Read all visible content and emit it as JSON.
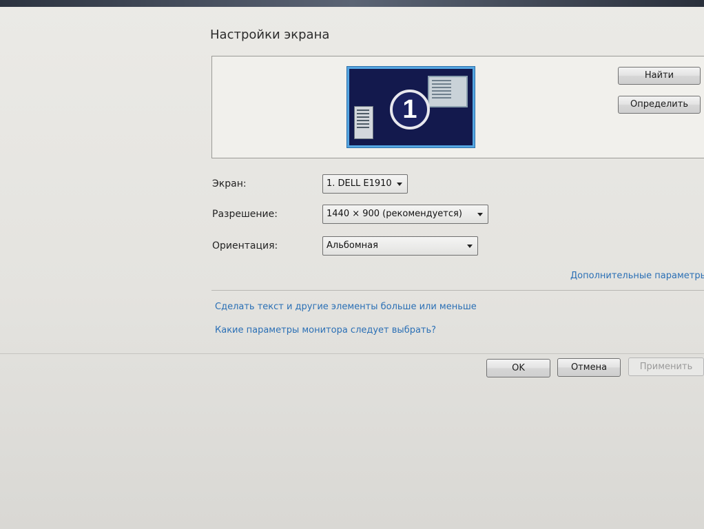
{
  "window": {
    "title": "Настройки экрана"
  },
  "preview": {
    "monitor_number": "1",
    "find_label": "Найти",
    "identify_label": "Определить"
  },
  "settings": {
    "screen_label": "Экран:",
    "screen_value": "1. DELL E1910",
    "resolution_label": "Разрешение:",
    "resolution_value": "1440 × 900 (рекомендуется)",
    "orientation_label": "Ориентация:",
    "orientation_value": "Альбомная"
  },
  "links": {
    "advanced": "Дополнительные параметры",
    "text_size": "Сделать текст и другие элементы больше или меньше",
    "monitor_help": "Какие параметры монитора следует выбрать?"
  },
  "footer": {
    "ok_label": "OK",
    "cancel_label": "Отмена",
    "apply_label": "Применить"
  },
  "colors": {
    "monitor_bg": "#13194d",
    "monitor_border": "#55a6e2",
    "link": "#2a6fb5"
  }
}
